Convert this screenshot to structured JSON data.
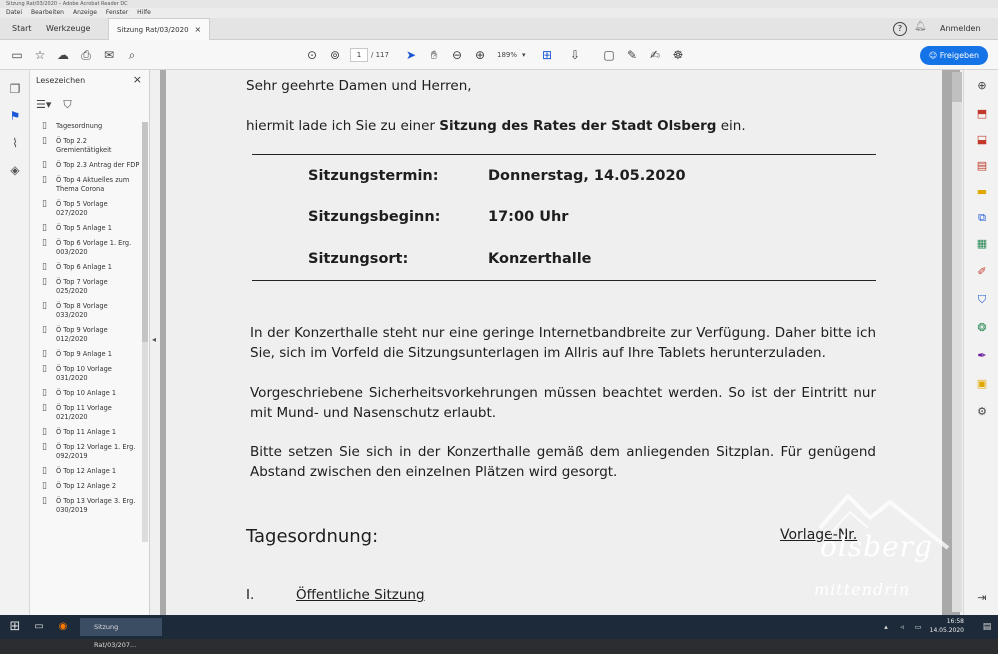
{
  "window": {
    "title": "Sitzung Rat/03/2020 – Adobe Acrobat Reader DC"
  },
  "menu": [
    "Datei",
    "Bearbeiten",
    "Anzeige",
    "Fenster",
    "Hilfe"
  ],
  "tabs": {
    "home": "Start",
    "tools": "Werkzeuge",
    "document": "Sitzung Rat/03/2020",
    "close": "×"
  },
  "toolbar": {
    "page_current": "1",
    "page_total": "/ 117",
    "zoom": "189%",
    "share_label": "Freigeben",
    "signin_label": "Anmelden",
    "help": "?"
  },
  "bookmarks": {
    "title": "Lesezeichen",
    "close": "×",
    "items": [
      "Tagesordnung",
      "Ö Top 2.2 Gremientätigkeit",
      "Ö Top 2.3 Antrag der FDP",
      "Ö Top 4 Aktuelles zum Thema Corona",
      "Ö Top 5 Vorlage 027/2020",
      "Ö Top 5 Anlage 1",
      "Ö Top 6 Vorlage 1. Erg. 003/2020",
      "Ö Top 6 Anlage 1",
      "Ö Top 7 Vorlage 025/2020",
      "Ö Top 8 Vorlage 033/2020",
      "Ö Top 9 Vorlage 012/2020",
      "Ö Top 9 Anlage 1",
      "Ö Top 10 Vorlage 031/2020",
      "Ö Top 10 Anlage 1",
      "Ö Top 11 Vorlage 021/2020",
      "Ö Top 11 Anlage 1",
      "Ö Top 12 Vorlage 1. Erg. 092/2019",
      "Ö Top 12 Anlage 1",
      "Ö Top 12 Anlage 2",
      "Ö Top 13 Vorlage 3. Erg. 030/2019"
    ]
  },
  "document": {
    "salutation": "Sehr geehrte Damen und Herren,",
    "invite_pre": "hiermit lade ich Sie zu einer ",
    "invite_bold": "Sitzung des Rates der Stadt Olsberg",
    "invite_post": " ein.",
    "details": [
      {
        "label": "Sitzungstermin:",
        "value": "Donnerstag, 14.05.2020"
      },
      {
        "label": "Sitzungsbeginn:",
        "value": "17:00 Uhr"
      },
      {
        "label": "Sitzungsort:",
        "value": "Konzerthalle"
      }
    ],
    "para1": "In der Konzerthalle steht nur eine geringe Internetbandbreite zur Verfügung. Daher bitte ich Sie, sich im Vorfeld die Sitzungsunterlagen im Allris auf Ihre Tablets herunterzuladen.",
    "para2": "Vorgeschriebene Sicherheitsvorkehrungen müssen beachtet werden. So ist der Eintritt nur mit Mund- und Nasenschutz erlaubt.",
    "para3": "Bitte setzen Sie sich in der Konzerthalle gemäß dem anliegenden Sitzplan. Für genügend Abstand zwischen den einzelnen Plätzen wird gesorgt.",
    "agenda_heading": "Tagesordnung:",
    "vorlage_heading": "Vorlage-Nr.",
    "section_num": "I.",
    "section_title": "Öffentliche Sitzung"
  },
  "taskbar": {
    "app_label": "Sitzung Rat/03/207...",
    "time": "16:58",
    "date": "14.05.2020"
  },
  "watermark": {
    "line1": "olsberg",
    "line2": "mittendrin"
  },
  "colors": {
    "accent": "#1473e6",
    "taskbar": "#1c2a3a"
  }
}
